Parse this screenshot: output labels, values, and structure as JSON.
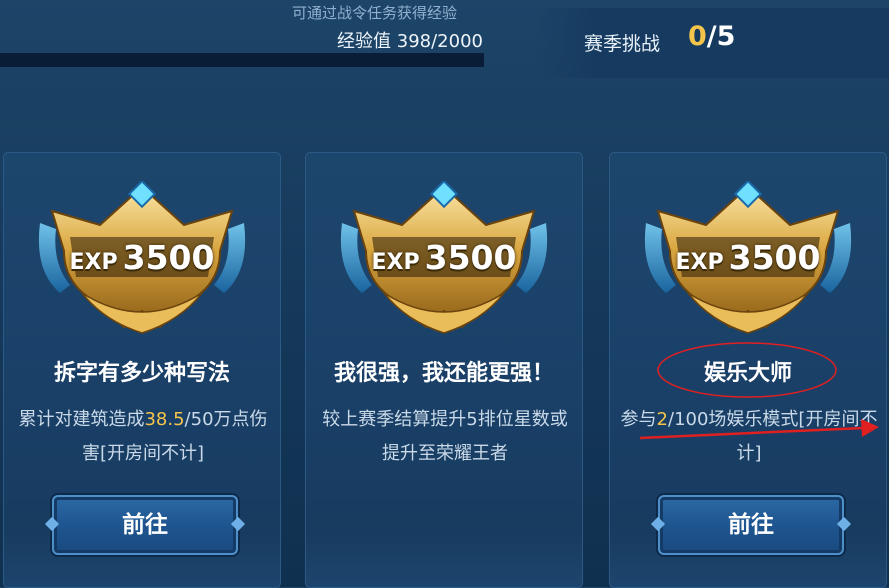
{
  "header": {
    "hint": "可通过战令任务获得经验",
    "exp_label": "经验值",
    "exp_value": "398/2000",
    "exp_progress": 0.199
  },
  "season": {
    "label": "赛季挑战",
    "current": "0",
    "separator": "/",
    "total": "5"
  },
  "cards": [
    {
      "badge_label": "EXP",
      "badge_value": "3500",
      "title": "拆字有多少种写法",
      "desc_pre": "累计对建筑造成",
      "desc_highlight": "38.5",
      "desc_post": "/50万点伤害[开房间不计]",
      "button_label": "前往"
    },
    {
      "badge_label": "EXP",
      "badge_value": "3500",
      "title": "我很强，我还能更强！",
      "desc": "较上赛季结算提升5排位星数或提升至荣耀王者"
    },
    {
      "badge_label": "EXP",
      "badge_value": "3500",
      "title": "娱乐大师",
      "desc_pre": "参与",
      "desc_highlight": "2",
      "desc_post": "/100场娱乐模式[开房间不计]",
      "button_label": "前往"
    }
  ],
  "colors": {
    "highlight": "#f4c54a",
    "annotation": "#e02020",
    "background": "#163a5c"
  },
  "icons": {
    "badge": "exp-crown-badge-icon"
  }
}
